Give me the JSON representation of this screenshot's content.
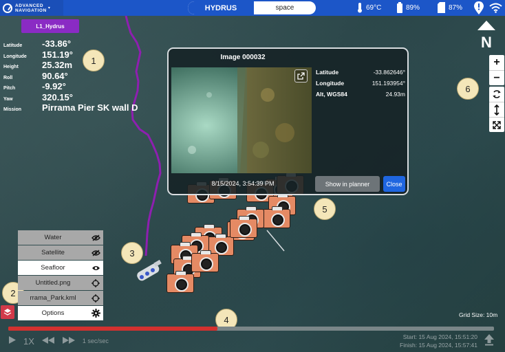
{
  "brand": {
    "line1": "ADVANCED",
    "line2": "NAVIGATION",
    "chevron": "▾"
  },
  "vehicle_toggle": {
    "active": "HYDRUS",
    "other": "space"
  },
  "status": {
    "temperature": "69°C",
    "battery": "89%",
    "storage": "87%"
  },
  "vehicle_tag": "L1_Hydrus",
  "telemetry": [
    {
      "label": "Latitude",
      "value": "-33.86°"
    },
    {
      "label": "Longitude",
      "value": "151.19°"
    },
    {
      "label": "Height",
      "value": "25.32m"
    },
    {
      "label": "Roll",
      "value": "90.64°"
    },
    {
      "label": "Pitch",
      "value": "-9.92°"
    },
    {
      "label": "Yaw",
      "value": "320.15°"
    },
    {
      "label": "Mission",
      "value": "Pirrama Pier SK wall D"
    }
  ],
  "callouts": [
    "1",
    "2",
    "3",
    "4",
    "5",
    "6"
  ],
  "compass_letter": "N",
  "zoom": {
    "in": "+",
    "out": "−"
  },
  "popup": {
    "title": "Image 000032",
    "stats": [
      {
        "label": "Latitude",
        "value": "-33.862646°"
      },
      {
        "label": "Longitude",
        "value": "151.193954°"
      },
      {
        "label": "Alt, WGS84",
        "value": "24.93m"
      }
    ],
    "timestamp": "8/15/2024, 3:54:39 PM",
    "planner_button": "Show in planner",
    "close_button": "Close"
  },
  "layers": [
    {
      "name": "Water",
      "icon": "eye-off-icon",
      "style": "gray"
    },
    {
      "name": "Satellite",
      "icon": "eye-off-icon",
      "style": "gray"
    },
    {
      "name": "Seafloor",
      "icon": "eye-icon",
      "style": "white"
    },
    {
      "name": "Untitled.png",
      "icon": "crosshair-icon",
      "style": "gray"
    },
    {
      "name": "rrama_Park.kml",
      "icon": "crosshair-icon",
      "style": "gray"
    },
    {
      "name": "Options",
      "icon": "gear-icon",
      "style": "white"
    }
  ],
  "grid_size": "Grid Size: 10m",
  "playback": {
    "rate_label": "1X",
    "speed": "1 sec/sec",
    "progress": 0.43
  },
  "times": {
    "start": "Start: 15 Aug 2024, 15:51:20",
    "finish": "Finish: 15 Aug 2024, 15:57:41"
  },
  "colors": {
    "topbar": "#1c56c8",
    "vehicle_tag": "#8a2bc4",
    "path": "#8e1fb0",
    "markers": "#e58a64",
    "timeline_fill": "#d3312f"
  }
}
